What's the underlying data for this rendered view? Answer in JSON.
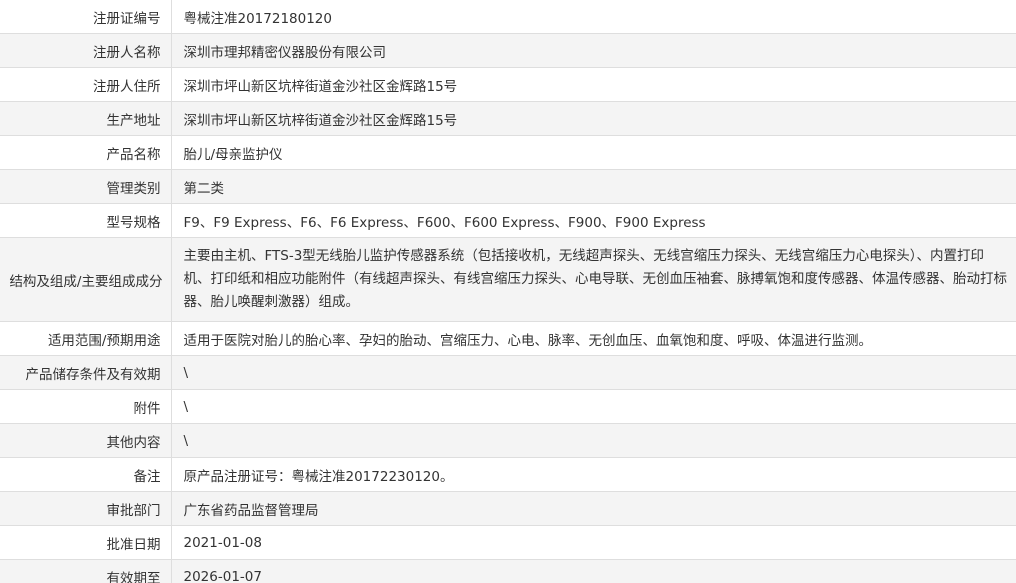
{
  "rows": [
    {
      "label": "注册证编号",
      "value": "粤械注准20172180120"
    },
    {
      "label": "注册人名称",
      "value": "深圳市理邦精密仪器股份有限公司"
    },
    {
      "label": "注册人住所",
      "value": "深圳市坪山新区坑梓街道金沙社区金辉路15号"
    },
    {
      "label": "生产地址",
      "value": "深圳市坪山新区坑梓街道金沙社区金辉路15号"
    },
    {
      "label": "产品名称",
      "value": "胎儿/母亲监护仪"
    },
    {
      "label": "管理类别",
      "value": "第二类"
    },
    {
      "label": "型号规格",
      "value": "F9、F9 Express、F6、F6 Express、F600、F600 Express、F900、F900 Express"
    },
    {
      "label": "结构及组成/主要组成成分",
      "value": "主要由主机、FTS-3型无线胎儿监护传感器系统（包括接收机，无线超声探头、无线宫缩压力探头、无线宫缩压力心电探头）、内置打印机、打印纸和相应功能附件（有线超声探头、有线宫缩压力探头、心电导联、无创血压袖套、脉搏氧饱和度传感器、体温传感器、胎动打标器、胎儿唤醒刺激器）组成。"
    },
    {
      "label": "适用范围/预期用途",
      "value": "适用于医院对胎儿的胎心率、孕妇的胎动、宫缩压力、心电、脉率、无创血压、血氧饱和度、呼吸、体温进行监测。"
    },
    {
      "label": "产品储存条件及有效期",
      "value": "\\"
    },
    {
      "label": "附件",
      "value": "\\"
    },
    {
      "label": "其他内容",
      "value": "\\"
    },
    {
      "label": "备注",
      "value": "原产品注册证号：粤械注准20172230120。"
    },
    {
      "label": "审批部门",
      "value": "广东省药品监督管理局"
    },
    {
      "label": "批准日期",
      "value": "2021-01-08"
    },
    {
      "label": "有效期至",
      "value": "2026-01-07"
    }
  ]
}
